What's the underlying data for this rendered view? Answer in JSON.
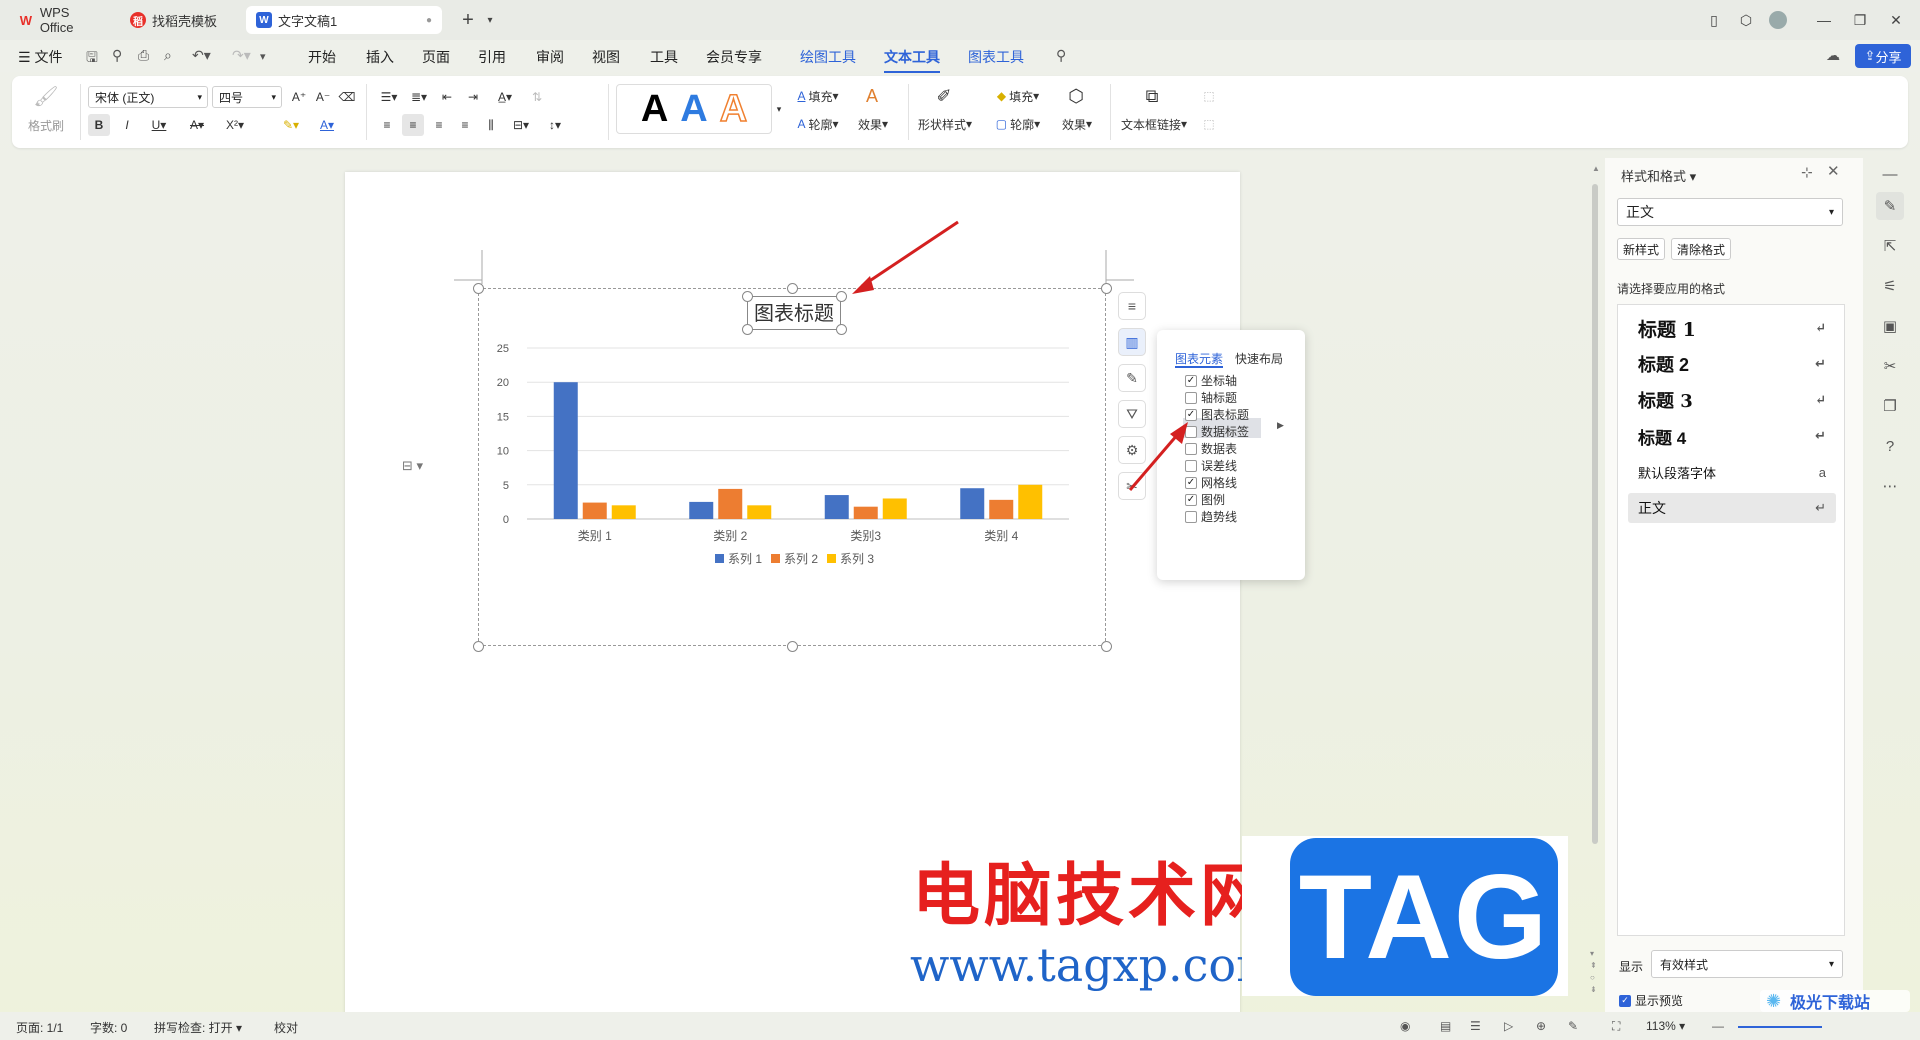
{
  "tabs": [
    {
      "label": "WPS Office",
      "icon": "wps-logo-icon"
    },
    {
      "label": "找稻壳模板",
      "icon": "docer-icon"
    },
    {
      "label": "文字文稿1",
      "icon": "word-doc-icon"
    }
  ],
  "menu": {
    "file": "文件",
    "items": [
      "开始",
      "插入",
      "页面",
      "引用",
      "审阅",
      "视图",
      "工具",
      "会员专享"
    ],
    "context_tabs": [
      "绘图工具",
      "文本工具",
      "图表工具"
    ],
    "active_context": "文本工具",
    "share": "分享"
  },
  "ribbon": {
    "format_painter": "格式刷",
    "font_name": "宋体 (正文)",
    "font_size": "四号",
    "fill": "填充",
    "outline": "轮廓",
    "effect": "效果",
    "shape_style": "形状样式",
    "fill2": "填充",
    "outline2": "轮廓",
    "effect2": "效果",
    "textbox_link": "文本框链接"
  },
  "chart_data": {
    "type": "bar",
    "title": "图表标题",
    "categories": [
      "类别 1",
      "类别 2",
      "类别3",
      "类别 4"
    ],
    "series": [
      {
        "name": "系列 1",
        "values": [
          20,
          2.5,
          3.5,
          4.5
        ],
        "color": "#4472c4"
      },
      {
        "name": "系列 2",
        "values": [
          2.4,
          4.4,
          1.8,
          2.8
        ],
        "color": "#ed7d31"
      },
      {
        "name": "系列 3",
        "values": [
          2,
          2,
          3,
          5
        ],
        "color": "#ffc000"
      }
    ],
    "ylim": [
      0,
      25
    ],
    "yticks": [
      0,
      5,
      10,
      15,
      20,
      25
    ],
    "grid": true,
    "legend": "bottom"
  },
  "popup": {
    "tab_elements": "图表元素",
    "tab_layout": "快速布局",
    "items": [
      {
        "label": "坐标轴",
        "checked": true
      },
      {
        "label": "轴标题",
        "checked": false
      },
      {
        "label": "图表标题",
        "checked": true
      },
      {
        "label": "数据标签",
        "checked": false
      },
      {
        "label": "数据表",
        "checked": false
      },
      {
        "label": "误差线",
        "checked": false
      },
      {
        "label": "网格线",
        "checked": true
      },
      {
        "label": "图例",
        "checked": true
      },
      {
        "label": "趋势线",
        "checked": false
      }
    ]
  },
  "pane": {
    "title": "样式和格式",
    "current_style": "正文",
    "new_style": "新样式",
    "clear_format": "清除格式",
    "prompt": "请选择要应用的格式",
    "styles": [
      "标题  1",
      "标题  2",
      "标题  3",
      "标题 4",
      "默认段落字体",
      "正文"
    ],
    "show_label": "显示",
    "show_value": "有效样式",
    "preview_label": "显示预览"
  },
  "status": {
    "page": "页面: 1/1",
    "words": "字数: 0",
    "spell": "拼写检查: 打开",
    "proof": "校对",
    "zoom": "113%"
  },
  "watermark": {
    "line1": "电脑技术网",
    "line2": "www.tagxp.com",
    "tag": "TAG",
    "corner": "极光下载站"
  }
}
